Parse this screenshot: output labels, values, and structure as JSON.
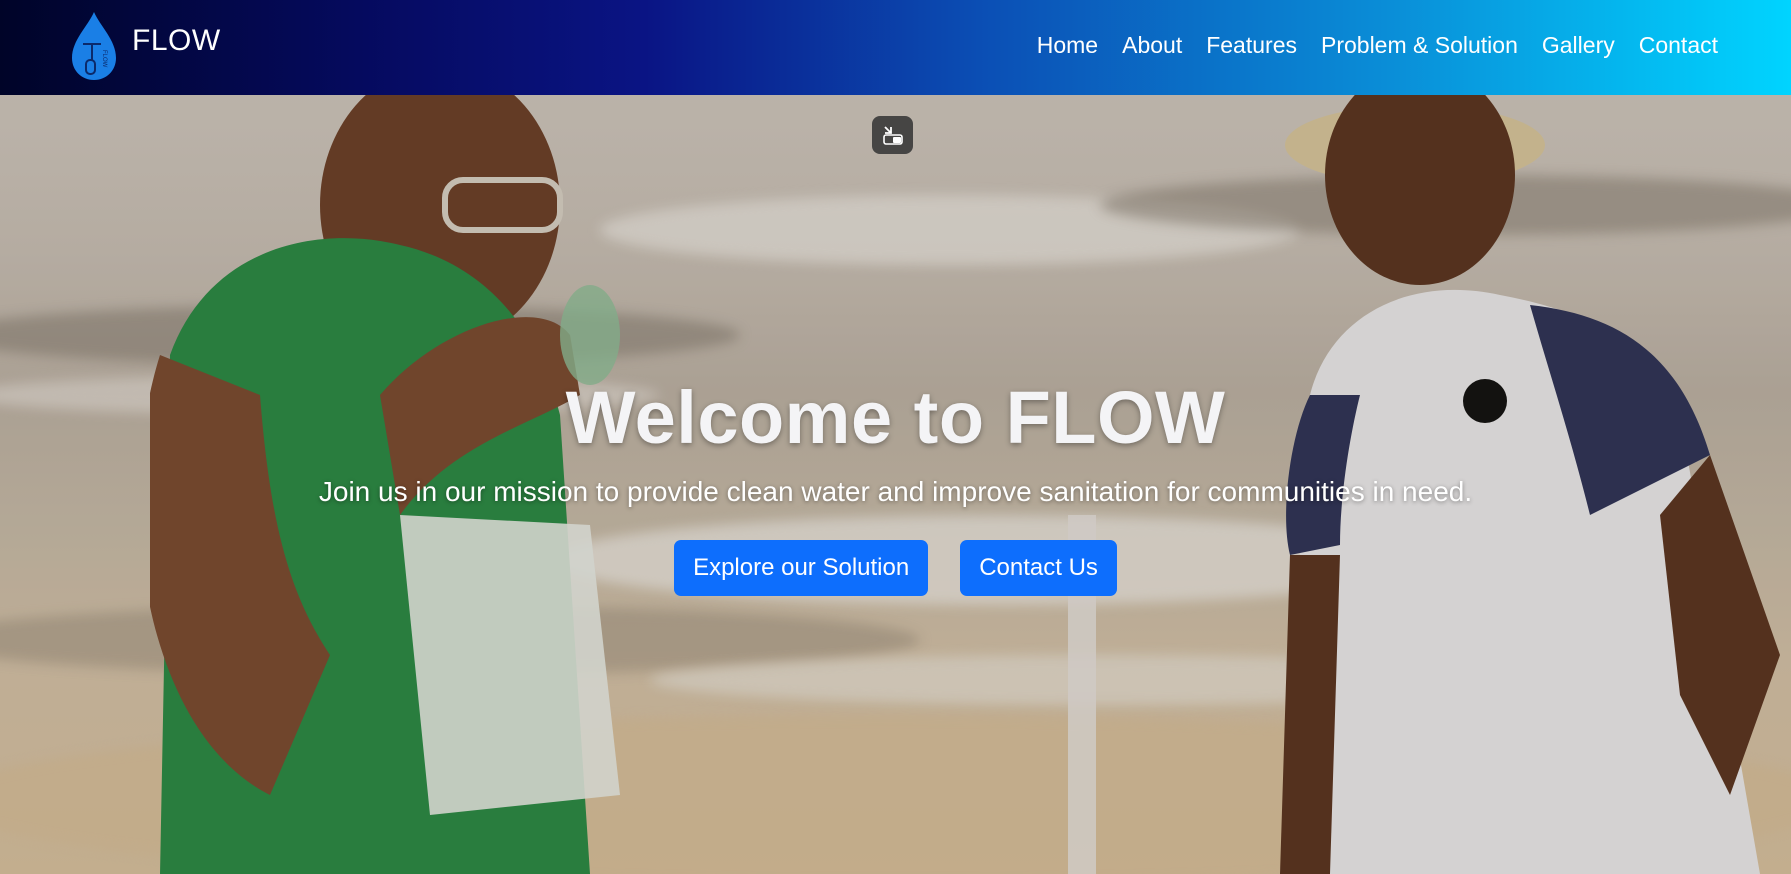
{
  "brand": {
    "name": "FLOW",
    "logo_icon": "water-drop-logo-icon",
    "logo_text": "FLOW"
  },
  "nav": {
    "items": [
      {
        "label": "Home"
      },
      {
        "label": "About"
      },
      {
        "label": "Features"
      },
      {
        "label": "Problem & Solution"
      },
      {
        "label": "Gallery"
      },
      {
        "label": "Contact"
      }
    ]
  },
  "hero": {
    "title": "Welcome to FLOW",
    "subtitle": "Join us in our mission to provide clean water and improve sanitation for communities in need.",
    "primary_button": "Explore our Solution",
    "secondary_button": "Contact Us",
    "background": "video-background",
    "pip_icon": "picture-in-picture-exit-icon"
  },
  "colors": {
    "button_primary": "#0d6efd",
    "nav_gradient_start": "#000428",
    "nav_gradient_end": "#00d4ff",
    "text": "#ffffff"
  }
}
